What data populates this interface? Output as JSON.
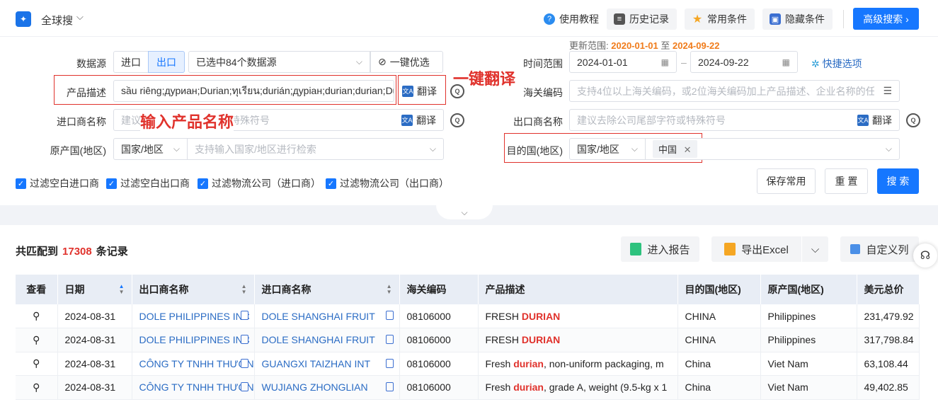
{
  "topbar": {
    "scope": "全球搜",
    "buttons": [
      {
        "label": "使用教程",
        "icon": "tutorial-icon"
      },
      {
        "label": "历史记录",
        "icon": "history-icon"
      },
      {
        "label": "常用条件",
        "icon": "star-icon"
      },
      {
        "label": "隐藏条件",
        "icon": "hide-icon"
      }
    ],
    "advanced": "高级搜索 ›"
  },
  "update": {
    "label": "更新范围:",
    "from": "2020-01-01",
    "sep": "至",
    "to": "2024-09-22"
  },
  "form": {
    "datasource": {
      "label": "数据源",
      "import": "进口",
      "export": "出口",
      "selected": "已选中84个数据源",
      "optimize": "一键优选"
    },
    "time": {
      "label": "时间范围",
      "from": "2024-01-01",
      "to": "2024-09-22",
      "quick": "快捷选项"
    },
    "product": {
      "label": "产品描述",
      "value": "sầu riêng;дуриан;Durian;ทุเรียน;durián;дуріан;durian;durian;Durian",
      "translate": "翻译"
    },
    "hs": {
      "label": "海关编码",
      "placeholder": "支持4位以上海关编码，或2位海关编码加上产品描述、企业名称的任意组合"
    },
    "importer": {
      "label": "进口商名称",
      "placeholder": "建议去除公司尾部字符或特殊符号",
      "translate": "翻译"
    },
    "exporter": {
      "label": "出口商名称",
      "placeholder": "建议去除公司尾部字符或特殊符号",
      "translate": "翻译"
    },
    "origin": {
      "label": "原产国(地区)",
      "type": "国家/地区",
      "placeholder": "支持输入国家/地区进行检索"
    },
    "dest": {
      "label": "目的国(地区)",
      "type": "国家/地区",
      "tag": "中国"
    },
    "annotations": {
      "translate": "一键翻译",
      "input": "输入产品名称"
    },
    "filters": [
      "过滤空白进口商",
      "过滤空白出口商",
      "过滤物流公司（进口商）",
      "过滤物流公司（出口商）"
    ],
    "save": "保存常用",
    "reset": "重 置",
    "search": "搜 索"
  },
  "results": {
    "prefix": "共匹配到",
    "count": "17308",
    "suffix": "条记录",
    "report": "进入报告",
    "excel": "导出Excel",
    "custom": "自定义列"
  },
  "table": {
    "headers": [
      "查看",
      "日期",
      "出口商名称",
      "进口商名称",
      "海关编码",
      "产品描述",
      "目的国(地区)",
      "原产国(地区)",
      "美元总价"
    ],
    "rows": [
      {
        "date": "2024-08-31",
        "exporter": "DOLE PHILIPPINES INC",
        "importer": "DOLE SHANGHAI FRUIT",
        "hs": "08106000",
        "desc_pre": "FRESH ",
        "desc_hl": "DURIAN",
        "desc_post": "",
        "dest": "CHINA",
        "origin": "Philippines",
        "usd": "231,479.92"
      },
      {
        "date": "2024-08-31",
        "exporter": "DOLE PHILIPPINES INC",
        "importer": "DOLE SHANGHAI FRUIT",
        "hs": "08106000",
        "desc_pre": "FRESH ",
        "desc_hl": "DURIAN",
        "desc_post": "",
        "dest": "CHINA",
        "origin": "Philippines",
        "usd": "317,798.84"
      },
      {
        "date": "2024-08-31",
        "exporter": "CÔNG TY TNHH THƯƠNG",
        "importer": "GUANGXI TAIZHAN INT",
        "hs": "08106000",
        "desc_pre": "Fresh ",
        "desc_hl": "durian",
        "desc_post": ", non-uniform packaging, m",
        "dest": "China",
        "origin": "Viet Nam",
        "usd": "63,108.44"
      },
      {
        "date": "2024-08-31",
        "exporter": "CÔNG TY TNHH THƯƠNG",
        "importer": "WUJIANG ZHONGLIAN",
        "hs": "08106000",
        "desc_pre": "Fresh ",
        "desc_hl": "durian",
        "desc_post": ", grade A, weight (9.5-kg x 1",
        "dest": "China",
        "origin": "Viet Nam",
        "usd": "49,402.85"
      }
    ]
  },
  "colors": {
    "accent": "#1677ff",
    "highlight": "#e0322c",
    "update": "#f07b1a"
  }
}
